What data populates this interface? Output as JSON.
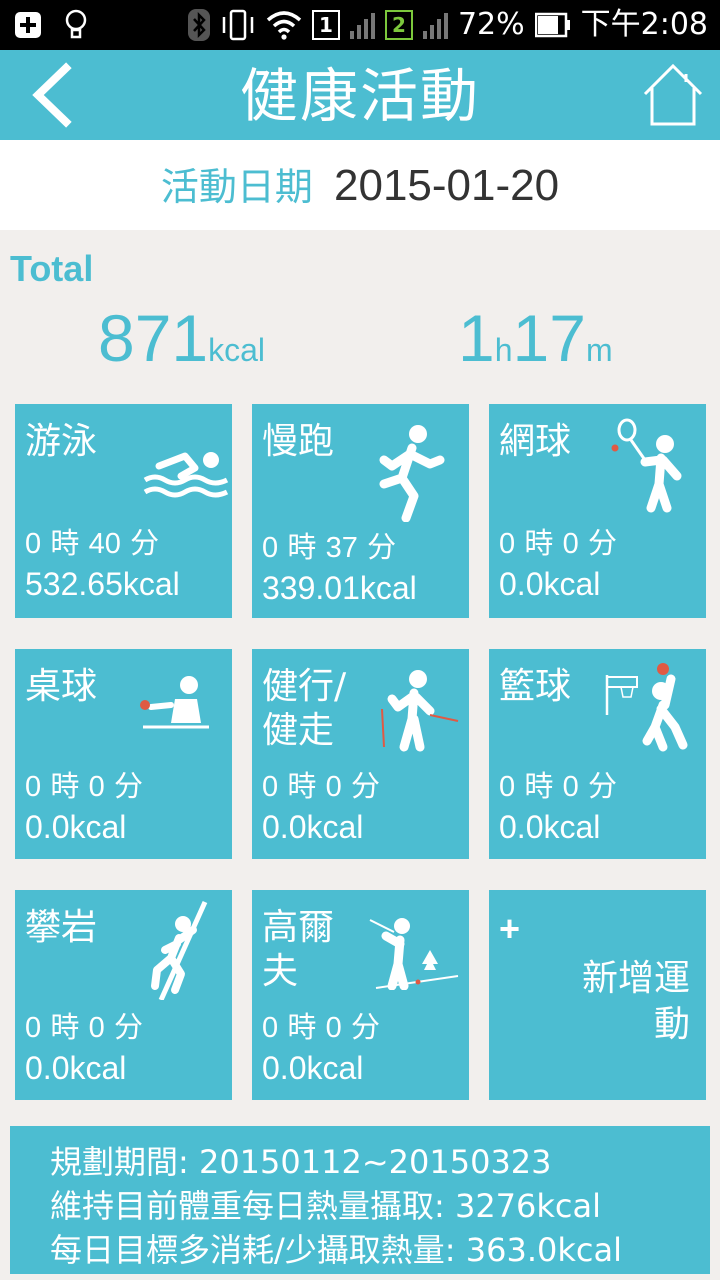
{
  "status_bar": {
    "battery": "72%",
    "time": "下午2:08",
    "sim1": "1",
    "sim2": "2",
    "icons": [
      "add-icon",
      "lightbulb-icon",
      "bluetooth-icon",
      "vibrate-icon",
      "wifi-icon",
      "battery-icon"
    ]
  },
  "header": {
    "title": "健康活動",
    "back_icon": "chevron-left-icon",
    "home_icon": "home-icon"
  },
  "date": {
    "label": "活動日期",
    "value": "2015-01-20"
  },
  "total": {
    "label": "Total",
    "kcal_value": "871",
    "kcal_unit": "kcal",
    "hours": "1",
    "hours_unit": "h",
    "minutes": "17",
    "minutes_unit": "m"
  },
  "activities": [
    {
      "name": "游泳",
      "hours": "0",
      "h_label": "時",
      "minutes": "40",
      "m_label": "分",
      "kcal": "532.65kcal",
      "icon": "swimming-icon"
    },
    {
      "name": "慢跑",
      "hours": "0",
      "h_label": "時",
      "minutes": "37",
      "m_label": "分",
      "kcal": "339.01kcal",
      "icon": "running-icon"
    },
    {
      "name": "網球",
      "hours": "0",
      "h_label": "時",
      "minutes": "0",
      "m_label": "分",
      "kcal": "0.0kcal",
      "icon": "tennis-icon"
    },
    {
      "name": "桌球",
      "hours": "0",
      "h_label": "時",
      "minutes": "0",
      "m_label": "分",
      "kcal": "0.0kcal",
      "icon": "table-tennis-icon"
    },
    {
      "name": "健行/健走",
      "hours": "0",
      "h_label": "時",
      "minutes": "0",
      "m_label": "分",
      "kcal": "0.0kcal",
      "icon": "hiking-icon"
    },
    {
      "name": "籃球",
      "hours": "0",
      "h_label": "時",
      "minutes": "0",
      "m_label": "分",
      "kcal": "0.0kcal",
      "icon": "basketball-icon"
    },
    {
      "name": "攀岩",
      "hours": "0",
      "h_label": "時",
      "minutes": "0",
      "m_label": "分",
      "kcal": "0.0kcal",
      "icon": "climbing-icon"
    },
    {
      "name": "高爾夫",
      "hours": "0",
      "h_label": "時",
      "minutes": "0",
      "m_label": "分",
      "kcal": "0.0kcal",
      "icon": "golf-icon"
    }
  ],
  "add_activity": {
    "plus": "+",
    "label": "新增運動"
  },
  "plan": {
    "line1": "規劃期間: 20150112~20150323",
    "line2": "維持目前體重每日熱量攝取: 3276kcal",
    "line3": "每日目標多消耗/少攝取熱量: 363.0kcal"
  },
  "colors": {
    "accent": "#4cbdd1",
    "tile_text": "#ffffff",
    "ball_red": "#e05a44"
  }
}
